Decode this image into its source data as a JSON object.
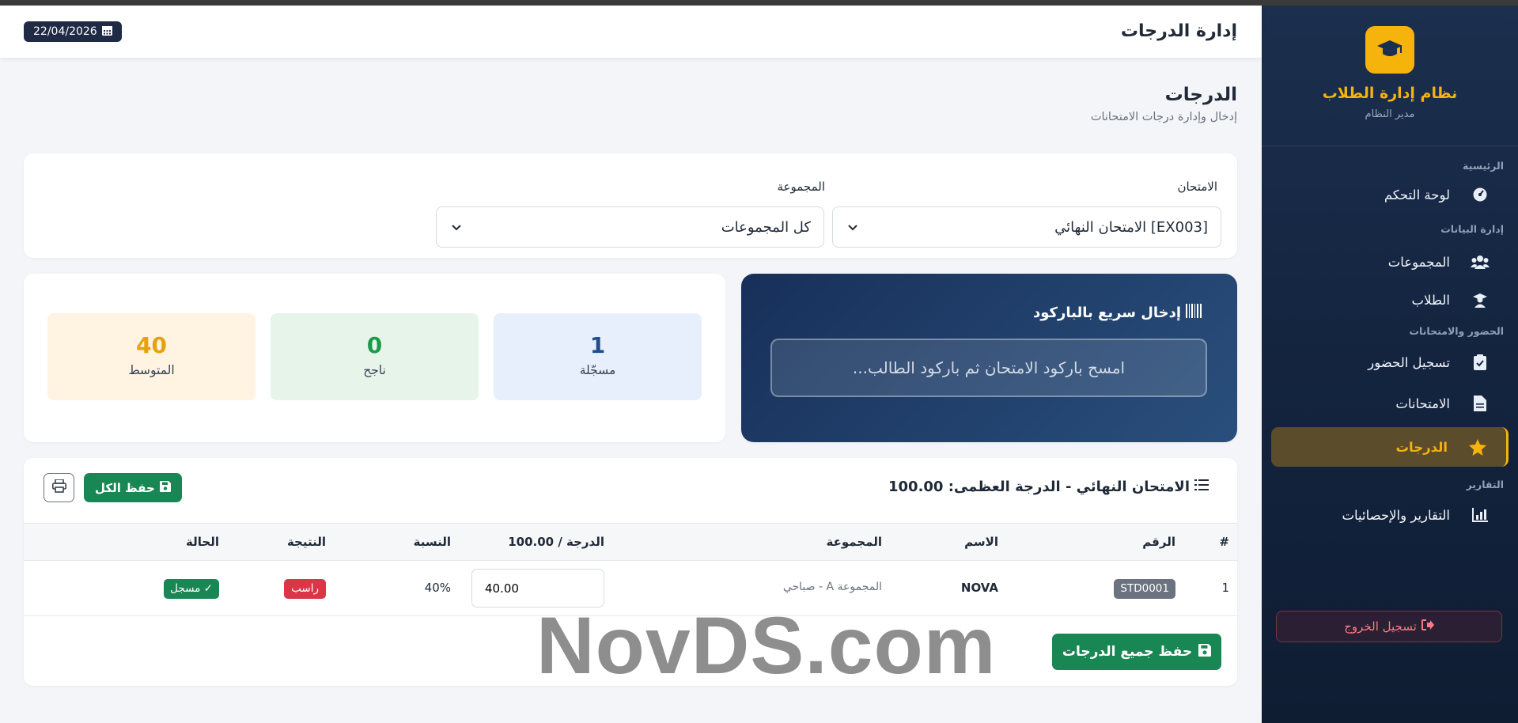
{
  "header": {
    "title": "إدارة الدرجات",
    "date": "22/04/2026"
  },
  "sidebar": {
    "brand_title": "نظام إدارة الطلاب",
    "brand_subtitle": "مدير النظام",
    "sections": {
      "home": "الرئيسية",
      "data": "إدارة البيانات",
      "attendance": "الحضور والامتحانات",
      "reports": "التقارير"
    },
    "items": [
      {
        "label": "لوحة التحكم",
        "icon": "dashboard-icon"
      },
      {
        "label": "المجموعات",
        "icon": "users-icon"
      },
      {
        "label": "الطلاب",
        "icon": "student-icon"
      },
      {
        "label": "تسجيل الحضور",
        "icon": "clipboard-check-icon"
      },
      {
        "label": "الامتحانات",
        "icon": "file-icon"
      },
      {
        "label": "الدرجات",
        "icon": "star-icon",
        "active": true
      },
      {
        "label": "التقارير والإحصائيات",
        "icon": "chart-icon"
      }
    ],
    "logout": "تسجيل الخروج"
  },
  "page": {
    "title": "الدرجات",
    "subtitle": "إدخال وإدارة درجات الامتحانات"
  },
  "filters": {
    "exam_label": "الامتحان",
    "exam_value": "[EX003] الامتحان النهائي",
    "group_label": "المجموعة",
    "group_value": "كل المجموعات"
  },
  "barcode": {
    "title": "إدخال سريع بالباركود",
    "placeholder": "امسح باركود الامتحان ثم باركود الطالب..."
  },
  "stats": [
    {
      "value": "1",
      "label": "مسجّلة"
    },
    {
      "value": "0",
      "label": "ناجح"
    },
    {
      "value": "40",
      "label": "المتوسط"
    }
  ],
  "table": {
    "title": "الامتحان النهائي - الدرجة العظمى: 100.00",
    "save_all_label": "حفظ الكل",
    "columns": [
      "#",
      "الرقم",
      "الاسم",
      "المجموعة",
      "الدرجة / 100.00",
      "النسبة",
      "النتيجة",
      "الحالة"
    ],
    "rows": [
      {
        "index": "1",
        "id": "STD0001",
        "name": "NOVA",
        "group": "المجموعة A - صباحي",
        "grade": "40.00",
        "percent": "40%",
        "result": "راسب",
        "status": "✓ مسجل"
      }
    ],
    "save_grades_label": "حفظ جميع الدرجات"
  },
  "watermark": "NovDS.com",
  "colors": {
    "accent": "#f5b30b",
    "sidebar_bg": "#142540",
    "success": "#198754",
    "danger": "#dc3545"
  }
}
